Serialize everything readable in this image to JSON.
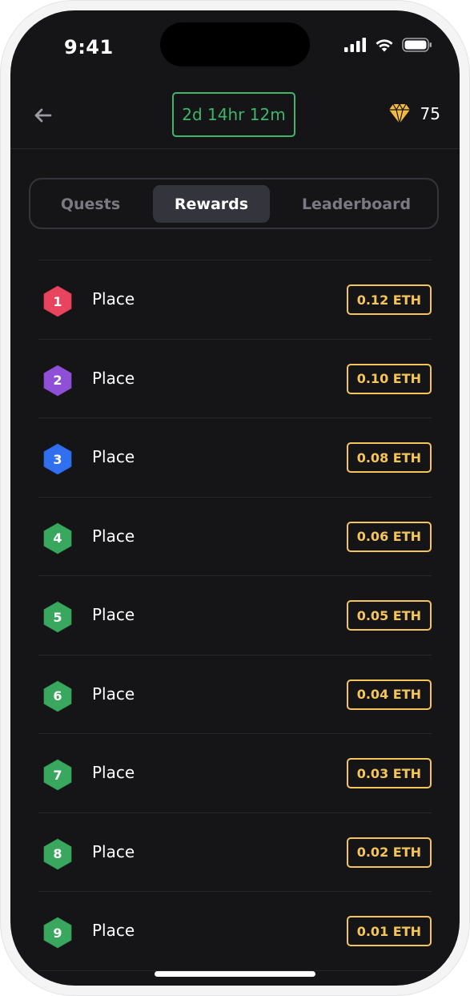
{
  "status_bar": {
    "time": "9:41"
  },
  "header": {
    "timer": "2d 14hr 12m",
    "gems": "75"
  },
  "tabs": [
    {
      "label": "Quests",
      "active": false
    },
    {
      "label": "Rewards",
      "active": true
    },
    {
      "label": "Leaderboard",
      "active": false
    }
  ],
  "rewards": [
    {
      "rank": "1",
      "label": "Place",
      "amount": "0.12 ETH",
      "color": "#e8435f"
    },
    {
      "rank": "2",
      "label": "Place",
      "amount": "0.10 ETH",
      "color": "#8f4fd6"
    },
    {
      "rank": "3",
      "label": "Place",
      "amount": "0.08 ETH",
      "color": "#2f6ff0"
    },
    {
      "rank": "4",
      "label": "Place",
      "amount": "0.06 ETH",
      "color": "#3aa75e"
    },
    {
      "rank": "5",
      "label": "Place",
      "amount": "0.05 ETH",
      "color": "#3aa75e"
    },
    {
      "rank": "6",
      "label": "Place",
      "amount": "0.04 ETH",
      "color": "#3aa75e"
    },
    {
      "rank": "7",
      "label": "Place",
      "amount": "0.03 ETH",
      "color": "#3aa75e"
    },
    {
      "rank": "8",
      "label": "Place",
      "amount": "0.02 ETH",
      "color": "#3aa75e"
    },
    {
      "rank": "9",
      "label": "Place",
      "amount": "0.01 ETH",
      "color": "#3aa75e"
    }
  ],
  "colors": {
    "accent_green": "#3fb56a",
    "eth_gold": "#f5c55a",
    "background": "#151517"
  }
}
